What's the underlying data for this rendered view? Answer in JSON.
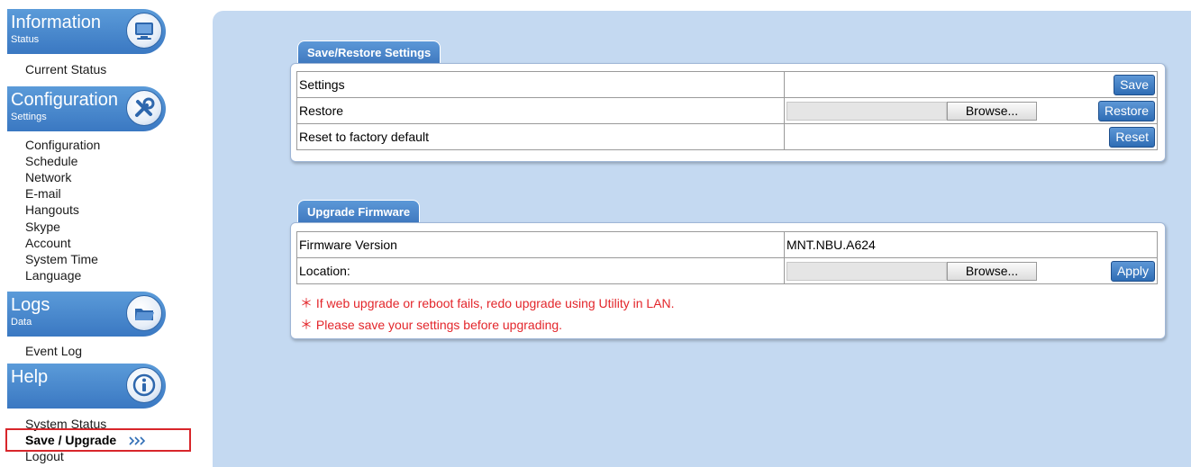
{
  "sidebar": {
    "information": {
      "title": "Information",
      "subtitle": "Status",
      "icon": "monitor-icon",
      "items": [
        {
          "label": "Current Status"
        }
      ]
    },
    "configuration": {
      "title": "Configuration",
      "subtitle": "Settings",
      "icon": "tools-icon",
      "items": [
        {
          "label": "Configuration"
        },
        {
          "label": "Schedule"
        },
        {
          "label": "Network"
        },
        {
          "label": "E-mail"
        },
        {
          "label": "Hangouts"
        },
        {
          "label": "Skype"
        },
        {
          "label": "Account"
        },
        {
          "label": "System Time"
        },
        {
          "label": "Language"
        }
      ]
    },
    "logs": {
      "title": "Logs",
      "subtitle": "Data",
      "icon": "folder-icon",
      "items": [
        {
          "label": "Event Log"
        }
      ]
    },
    "help": {
      "title": "Help",
      "icon": "info-icon",
      "items": [
        {
          "label": "System Status"
        },
        {
          "label": "Save / Upgrade",
          "active": true
        },
        {
          "label": "Logout"
        }
      ]
    }
  },
  "save_restore": {
    "tab_label": "Save/Restore Settings",
    "rows": {
      "settings": {
        "label": "Settings",
        "button": "Save"
      },
      "restore": {
        "label": "Restore",
        "browse": "Browse...",
        "button": "Restore"
      },
      "reset": {
        "label": "Reset to factory default",
        "button": "Reset"
      }
    }
  },
  "upgrade": {
    "tab_label": "Upgrade Firmware",
    "rows": {
      "firmware": {
        "label": "Firmware Version",
        "value": "MNT.NBU.A624"
      },
      "location": {
        "label": "Location:",
        "browse": "Browse...",
        "button": "Apply"
      }
    },
    "notes": [
      "＊ If web upgrade or reboot fails, redo upgrade using Utility in LAN.",
      "＊ Please save your settings before upgrading."
    ]
  },
  "colors": {
    "accent": "#3a78c2",
    "panel_bg": "#c4d9f1",
    "warning": "#e3262b",
    "highlight_border": "#d8262b"
  }
}
